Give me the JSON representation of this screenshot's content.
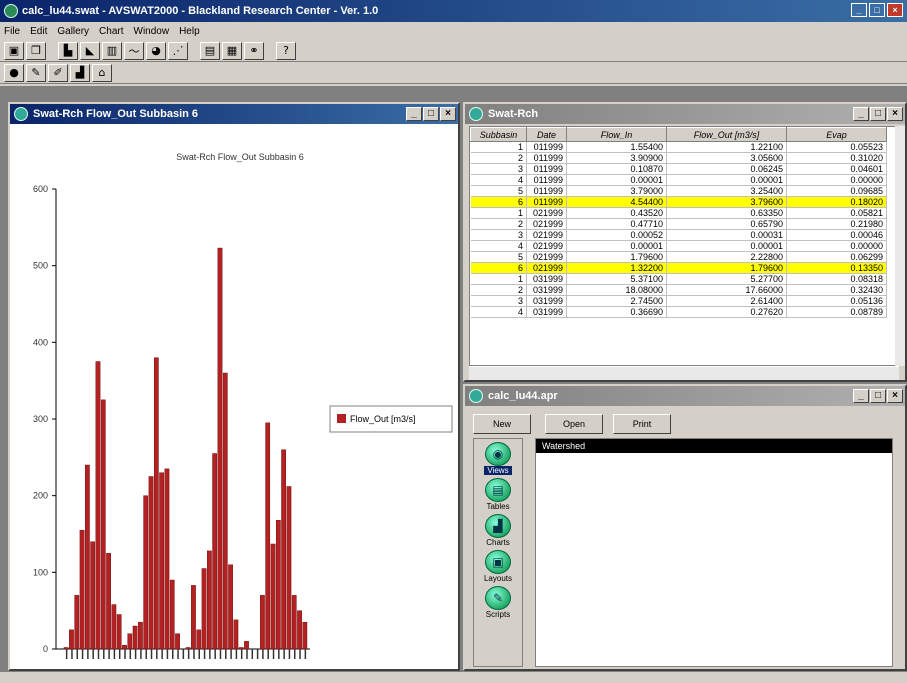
{
  "app": {
    "title": "calc_lu44.swat - AVSWAT2000 - Blackland Research Center - Ver. 1.0"
  },
  "menu": [
    "File",
    "Edit",
    "Gallery",
    "Chart",
    "Window",
    "Help"
  ],
  "toolbar1": [
    "save-icon",
    "copy-icon",
    "bar-chart-icon",
    "area-chart-icon",
    "column-chart-icon",
    "line-chart-icon",
    "pie-chart-icon",
    "xy-chart-icon",
    "properties-icon",
    "series-icon",
    "binoculars-icon",
    "help-icon"
  ],
  "toolbar2": [
    "info-icon",
    "edit-icon",
    "pencil-icon",
    "chart-icon",
    "lock-icon"
  ],
  "chart_window": {
    "title": "Swat-Rch Flow_Out Subbasin 6"
  },
  "chart_data": {
    "type": "bar",
    "title": "Swat-Rch Flow_Out Subbasin 6",
    "ylim": [
      0,
      600
    ],
    "yticks": [
      0,
      100,
      200,
      300,
      400,
      500,
      600
    ],
    "legend": {
      "label": "Flow_Out [m3/s]",
      "position": "right"
    },
    "series": [
      {
        "name": "Flow_Out [m3/s]",
        "color": "#b22222",
        "values": [
          2,
          25,
          70,
          155,
          240,
          140,
          375,
          325,
          125,
          58,
          45,
          5,
          20,
          30,
          35,
          200,
          225,
          380,
          230,
          235,
          90,
          20,
          0,
          2,
          83,
          25,
          105,
          128,
          255,
          523,
          360,
          110,
          38,
          2,
          10,
          0,
          0,
          70,
          295,
          137,
          168,
          260,
          212,
          70,
          50,
          35
        ]
      }
    ]
  },
  "table_window": {
    "title": "Swat-Rch",
    "columns": [
      "Subbasin",
      "Date",
      "Flow_In",
      "Flow_Out [m3/s]",
      "Evap"
    ],
    "rows": [
      [
        "1",
        "011999",
        "1.55400",
        "1.22100",
        "0.05523"
      ],
      [
        "2",
        "011999",
        "3.90900",
        "3.05600",
        "0.31020"
      ],
      [
        "3",
        "011999",
        "0.10870",
        "0.06245",
        "0.04601"
      ],
      [
        "4",
        "011999",
        "0.00001",
        "0.00001",
        "0.00000"
      ],
      [
        "5",
        "011999",
        "3.79000",
        "3.25400",
        "0.09685"
      ],
      [
        "6",
        "011999",
        "4.54400",
        "3.79600",
        "0.18020"
      ],
      [
        "1",
        "021999",
        "0.43520",
        "0.63350",
        "0.05821"
      ],
      [
        "2",
        "021999",
        "0.47710",
        "0.65790",
        "0.21980"
      ],
      [
        "3",
        "021999",
        "0.00052",
        "0.00031",
        "0.00046"
      ],
      [
        "4",
        "021999",
        "0.00001",
        "0.00001",
        "0.00000"
      ],
      [
        "5",
        "021999",
        "1.79600",
        "2.22800",
        "0.06299"
      ],
      [
        "6",
        "021999",
        "1.32200",
        "1.79600",
        "0.13350"
      ],
      [
        "1",
        "031999",
        "5.37100",
        "5.27700",
        "0.08318"
      ],
      [
        "2",
        "031999",
        "18.08000",
        "17.66000",
        "0.32430"
      ],
      [
        "3",
        "031999",
        "2.74500",
        "2.61400",
        "0.05136"
      ],
      [
        "4",
        "031999",
        "0.36690",
        "0.27620",
        "0.08789"
      ]
    ],
    "highlighted_rows": [
      5,
      11
    ]
  },
  "project_window": {
    "title": "calc_lu44.apr",
    "buttons": {
      "new": "New",
      "open": "Open",
      "print": "Print"
    },
    "doc_types": [
      {
        "label": "Views",
        "icon": "globe-icon",
        "selected": true
      },
      {
        "label": "Tables",
        "icon": "table-icon",
        "selected": false
      },
      {
        "label": "Charts",
        "icon": "chart-icon",
        "selected": false
      },
      {
        "label": "Layouts",
        "icon": "layout-icon",
        "selected": false
      },
      {
        "label": "Scripts",
        "icon": "script-icon",
        "selected": false
      }
    ],
    "items": [
      "Watershed"
    ]
  },
  "colors": {
    "title_active": "#0a246a",
    "highlight_row": "#ffff00",
    "bar": "#b22222"
  }
}
